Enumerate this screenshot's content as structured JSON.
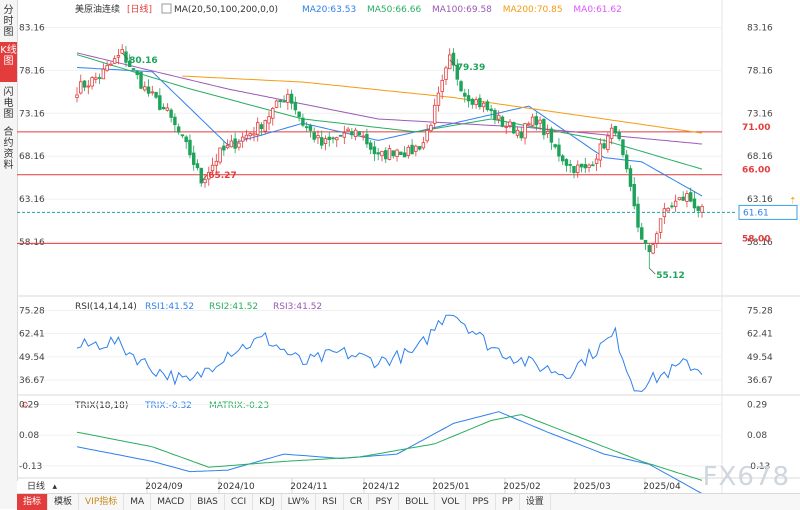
{
  "left_tabs": [
    {
      "label": "分时图",
      "active": false
    },
    {
      "label": "K线图",
      "active": true
    },
    {
      "label": "闪电图",
      "active": false
    },
    {
      "label": "合约资料",
      "active": false
    }
  ],
  "header": {
    "instrument": "美原油连续",
    "period": "[日线]",
    "ma_label": "MA(20,50,100,200,0,0)",
    "ma_values": [
      {
        "text": "MA20:63.53",
        "color": "#2f80ed"
      },
      {
        "text": "MA50:66.66",
        "color": "#27ae60"
      },
      {
        "text": "MA100:69.58",
        "color": "#9b59b6"
      },
      {
        "text": "MA200:70.85",
        "color": "#f39c12"
      },
      {
        "text": "MA0:61.62",
        "color": "#e056fd"
      }
    ]
  },
  "price_axis_ticks": [
    "83.16",
    "78.16",
    "73.16",
    "68.16",
    "63.16",
    "58.16"
  ],
  "price_lines": [
    {
      "label": "71.00",
      "value": 71.0
    },
    {
      "label": "66.00",
      "value": 66.0
    },
    {
      "label": "58.00",
      "value": 58.0
    }
  ],
  "current_price": {
    "label": "61.61",
    "value": 61.61
  },
  "annotations": [
    {
      "text": "80.16",
      "value": 80.16,
      "bar": 12
    },
    {
      "text": "65.27",
      "value": 65.27,
      "bar": 33
    },
    {
      "text": "79.39",
      "value": 79.39,
      "bar": 99
    },
    {
      "text": "55.12",
      "value": 55.12,
      "bar": 152
    }
  ],
  "x_axis_labels": [
    "2024/09",
    "2024/10",
    "2024/11",
    "2024/12",
    "2025/01",
    "2025/02",
    "2025/03",
    "2025/04"
  ],
  "rsi": {
    "title": "RSI(14,14,14)",
    "values_text": [
      {
        "text": "RSI1:41.52",
        "color": "#2f80ed"
      },
      {
        "text": "RSI2:41.52",
        "color": "#27ae60"
      },
      {
        "text": "RSI3:41.52",
        "color": "#9b59b6"
      }
    ],
    "ticks": [
      "75.28",
      "62.41",
      "49.54",
      "36.67"
    ]
  },
  "trix": {
    "title": "TRIX(18,18)",
    "values_text": [
      {
        "text": "TRIX:-0.32",
        "color": "#2f80ed"
      },
      {
        "text": "MATRIX:-0.23",
        "color": "#27ae60"
      }
    ],
    "ticks": [
      "0.29",
      "0.08",
      "-0.13"
    ]
  },
  "period_button": "日线",
  "bottom_tabs": [
    {
      "label": "指标",
      "active": true
    },
    {
      "label": "模板",
      "active": false
    },
    {
      "label": "VIP指标",
      "active": false,
      "vip": true
    },
    {
      "label": "MA",
      "active": false
    },
    {
      "label": "MACD",
      "active": false
    },
    {
      "label": "BIAS",
      "active": false
    },
    {
      "label": "CCI",
      "active": false
    },
    {
      "label": "KDJ",
      "active": false
    },
    {
      "label": "LW%",
      "active": false
    },
    {
      "label": "RSI",
      "active": false
    },
    {
      "label": "CR",
      "active": false
    },
    {
      "label": "PSY",
      "active": false
    },
    {
      "label": "BOLL",
      "active": false
    },
    {
      "label": "VOL",
      "active": false
    },
    {
      "label": "PPS",
      "active": false
    },
    {
      "label": "PP",
      "active": false
    },
    {
      "label": "设置",
      "active": false
    }
  ],
  "watermark": "FX678",
  "colors": {
    "up": "#e23c3c",
    "down": "#1ea35a",
    "level": "#e23c3c"
  },
  "chart_data": {
    "type": "candlestick",
    "title": "美原油连续 [日线]",
    "ylim": [
      53.5,
      84.5
    ],
    "x_start": "2024-08-15",
    "rsi_range": [
      30,
      80
    ],
    "trix_range": [
      -0.2,
      0.32
    ],
    "key_closes": [
      [
        0,
        76.0
      ],
      [
        6,
        77.5
      ],
      [
        12,
        80.16
      ],
      [
        18,
        76.0
      ],
      [
        24,
        73.2
      ],
      [
        30,
        68.5
      ],
      [
        33,
        65.27
      ],
      [
        38,
        68.5
      ],
      [
        43,
        70.0
      ],
      [
        48,
        71.5
      ],
      [
        52,
        73.5
      ],
      [
        56,
        75.5
      ],
      [
        60,
        72.0
      ],
      [
        65,
        69.5
      ],
      [
        70,
        70.5
      ],
      [
        75,
        71.0
      ],
      [
        80,
        68.0
      ],
      [
        85,
        69.0
      ],
      [
        88,
        68.5
      ],
      [
        92,
        69.8
      ],
      [
        95,
        73.5
      ],
      [
        99,
        79.39
      ],
      [
        103,
        75.5
      ],
      [
        108,
        74.0
      ],
      [
        113,
        72.0
      ],
      [
        118,
        71.0
      ],
      [
        122,
        72.5
      ],
      [
        127,
        69.0
      ],
      [
        131,
        67.0
      ],
      [
        135,
        66.5
      ],
      [
        139,
        69.0
      ],
      [
        143,
        71.5
      ],
      [
        146,
        66.0
      ],
      [
        149,
        60.0
      ],
      [
        152,
        56.5
      ],
      [
        155,
        61.0
      ],
      [
        158,
        62.5
      ],
      [
        162,
        63.5
      ],
      [
        166,
        61.62
      ]
    ],
    "ma_key": {
      "ma20": [
        [
          0,
          78.5
        ],
        [
          20,
          78.0
        ],
        [
          40,
          69.5
        ],
        [
          60,
          72.0
        ],
        [
          80,
          70.0
        ],
        [
          100,
          72.0
        ],
        [
          120,
          74.0
        ],
        [
          140,
          68.0
        ],
        [
          150,
          67.5
        ],
        [
          166,
          63.53
        ]
      ],
      "ma50": [
        [
          0,
          80.0
        ],
        [
          30,
          76.0
        ],
        [
          60,
          72.5
        ],
        [
          90,
          71.0
        ],
        [
          110,
          72.5
        ],
        [
          140,
          70.0
        ],
        [
          166,
          66.66
        ]
      ],
      "ma100": [
        [
          0,
          80.2
        ],
        [
          40,
          76.0
        ],
        [
          80,
          72.5
        ],
        [
          120,
          71.5
        ],
        [
          166,
          69.58
        ]
      ],
      "ma200": [
        [
          28,
          77.5
        ],
        [
          60,
          76.8
        ],
        [
          100,
          75.0
        ],
        [
          140,
          72.5
        ],
        [
          166,
          70.85
        ]
      ]
    },
    "rsi_key": [
      [
        0,
        55
      ],
      [
        10,
        58
      ],
      [
        20,
        43
      ],
      [
        30,
        35
      ],
      [
        40,
        52
      ],
      [
        50,
        60
      ],
      [
        60,
        46
      ],
      [
        70,
        52
      ],
      [
        80,
        47
      ],
      [
        90,
        52
      ],
      [
        99,
        76
      ],
      [
        110,
        55
      ],
      [
        120,
        46
      ],
      [
        130,
        40
      ],
      [
        143,
        62
      ],
      [
        148,
        32
      ],
      [
        152,
        36
      ],
      [
        158,
        42
      ],
      [
        162,
        46
      ],
      [
        166,
        41.52
      ]
    ],
    "trix_key": [
      [
        0,
        0.0
      ],
      [
        10,
        -0.05
      ],
      [
        20,
        -0.1
      ],
      [
        30,
        -0.17
      ],
      [
        40,
        -0.16
      ],
      [
        55,
        -0.05
      ],
      [
        70,
        -0.08
      ],
      [
        85,
        -0.05
      ],
      [
        100,
        0.16
      ],
      [
        112,
        0.24
      ],
      [
        125,
        0.1
      ],
      [
        140,
        -0.05
      ],
      [
        152,
        -0.12
      ],
      [
        166,
        -0.32
      ]
    ],
    "matrix_key": [
      [
        0,
        0.1
      ],
      [
        20,
        0.0
      ],
      [
        35,
        -0.14
      ],
      [
        55,
        -0.1
      ],
      [
        75,
        -0.07
      ],
      [
        95,
        0.02
      ],
      [
        110,
        0.18
      ],
      [
        118,
        0.22
      ],
      [
        135,
        0.05
      ],
      [
        150,
        -0.1
      ],
      [
        166,
        -0.23
      ]
    ]
  }
}
